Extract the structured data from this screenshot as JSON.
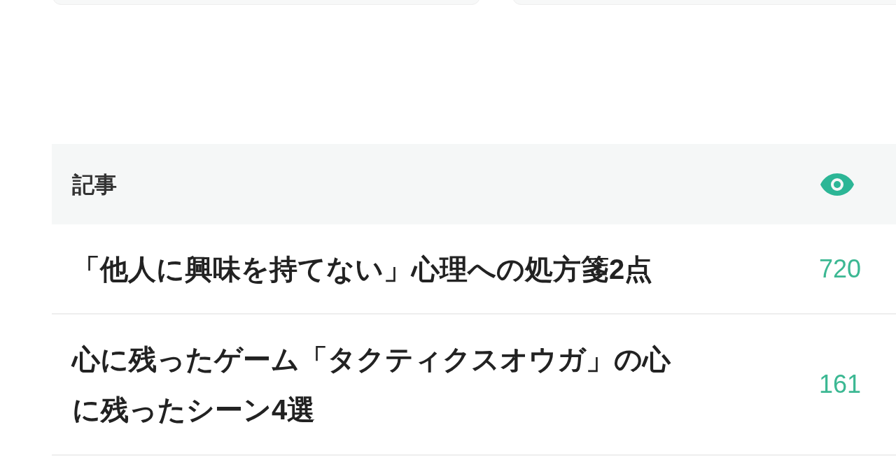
{
  "articles_table": {
    "header": "記事",
    "rows": [
      {
        "title": "「他人に興味を持てない」心理への処方箋2点",
        "views": "720"
      },
      {
        "title": "心に残ったゲーム「タクティクスオウガ」の心に残ったシーン4選",
        "views": "161"
      }
    ]
  }
}
